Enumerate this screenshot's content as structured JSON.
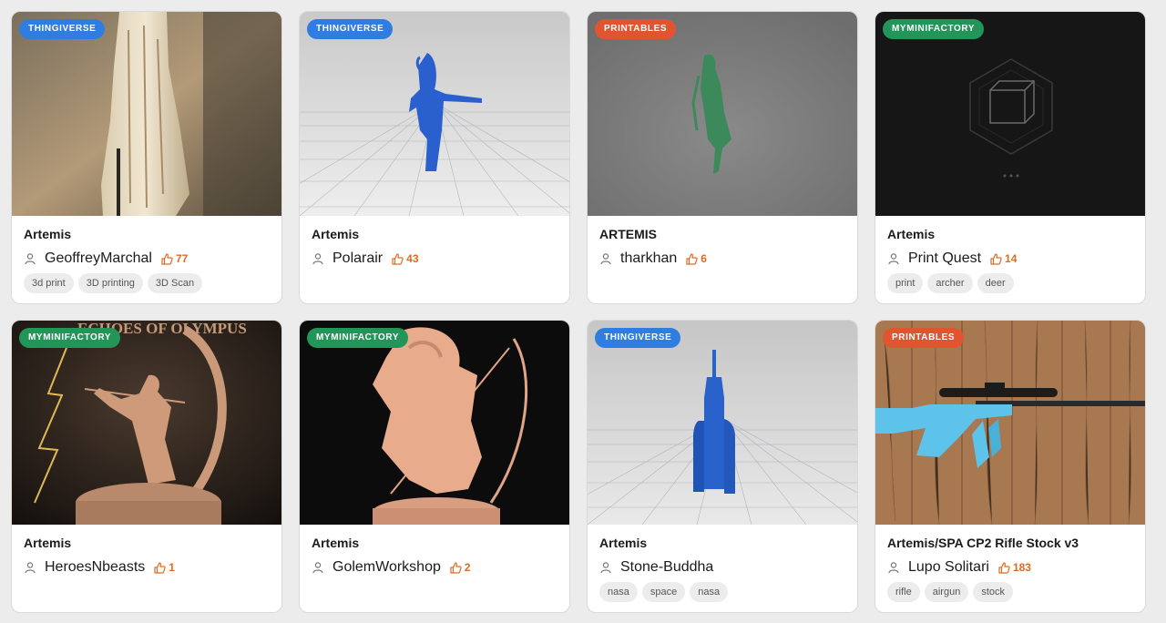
{
  "cards": [
    {
      "badge": "THINGIVERSE",
      "badge_color": "#2f7de1",
      "title": "Artemis",
      "author": "GeoffreyMarchal",
      "likes": "77",
      "tags": [
        "3d print",
        "3D printing",
        "3D Scan"
      ]
    },
    {
      "badge": "THINGIVERSE",
      "badge_color": "#2f7de1",
      "title": "Artemis",
      "author": "Polarair",
      "likes": "43",
      "tags": []
    },
    {
      "badge": "PRINTABLES",
      "badge_color": "#e0552f",
      "title": "ARTEMIS",
      "author": "tharkhan",
      "likes": "6",
      "tags": []
    },
    {
      "badge": "MYMINIFACTORY",
      "badge_color": "#229559",
      "title": "Artemis",
      "author": "Print Quest",
      "likes": "14",
      "tags": [
        "print",
        "archer",
        "deer"
      ]
    },
    {
      "badge": "MYMINIFACTORY",
      "badge_color": "#229559",
      "title": "Artemis",
      "author": "HeroesNbeasts",
      "likes": "1",
      "tags": []
    },
    {
      "badge": "MYMINIFACTORY",
      "badge_color": "#229559",
      "title": "Artemis",
      "author": "GolemWorkshop",
      "likes": "2",
      "tags": []
    },
    {
      "badge": "THINGIVERSE",
      "badge_color": "#2f7de1",
      "title": "Artemis",
      "author": "Stone-Buddha",
      "likes": "",
      "tags": [
        "nasa",
        "space",
        "nasa"
      ]
    },
    {
      "badge": "PRINTABLES",
      "badge_color": "#e0552f",
      "title": "Artemis/SPA CP2 Rifle Stock v3",
      "author": "Lupo Solitari",
      "likes": "183",
      "tags": [
        "rifle",
        "airgun",
        "stock"
      ]
    }
  ],
  "image_texts": {
    "echoes_banner": "ECHOES OF OLYMPUS"
  },
  "icons": {
    "user": "user-icon",
    "like": "thumbs-up-icon"
  },
  "colors": {
    "likes": "#e06a1e",
    "tag_bg": "#ececec"
  }
}
